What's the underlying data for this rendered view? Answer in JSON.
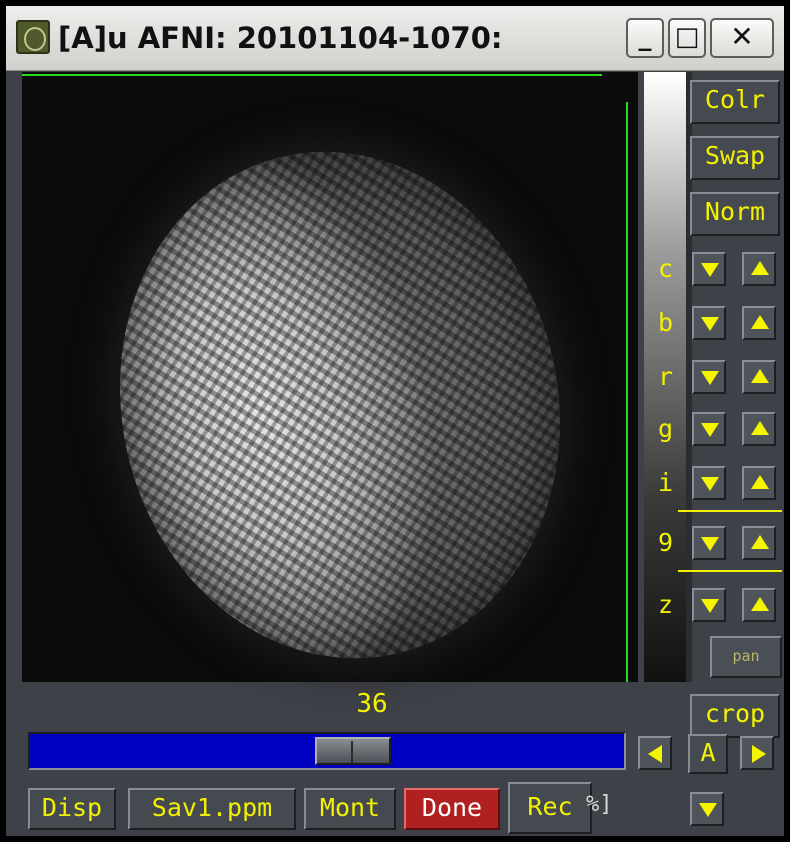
{
  "window": {
    "title": "[A]u AFNI: 20101104-1070:",
    "controls": {
      "minimize": "_",
      "maximize": "□",
      "close": "✕"
    }
  },
  "image": {
    "slice_number": "36",
    "slider_fraction": 0.55
  },
  "side_buttons": {
    "colr": "Colr",
    "swap": "Swap",
    "norm": "Norm",
    "crop": "crop",
    "pan": "pan"
  },
  "adjust_rows": [
    {
      "label": "c"
    },
    {
      "label": "b"
    },
    {
      "label": "r"
    },
    {
      "label": "g"
    },
    {
      "label": "i"
    },
    {
      "label": "9"
    },
    {
      "label": "z"
    }
  ],
  "nav": {
    "center_label": "A",
    "stray_text": "%]"
  },
  "bottom_buttons": {
    "disp": "Disp",
    "save": "Sav1.ppm",
    "mont": "Mont",
    "done": "Done",
    "rec": "Rec"
  },
  "colors": {
    "label_yellow": "#f2f200",
    "slider_blue": "#0000c0",
    "done_red": "#b02020",
    "crosshair_green": "#22dd22"
  }
}
